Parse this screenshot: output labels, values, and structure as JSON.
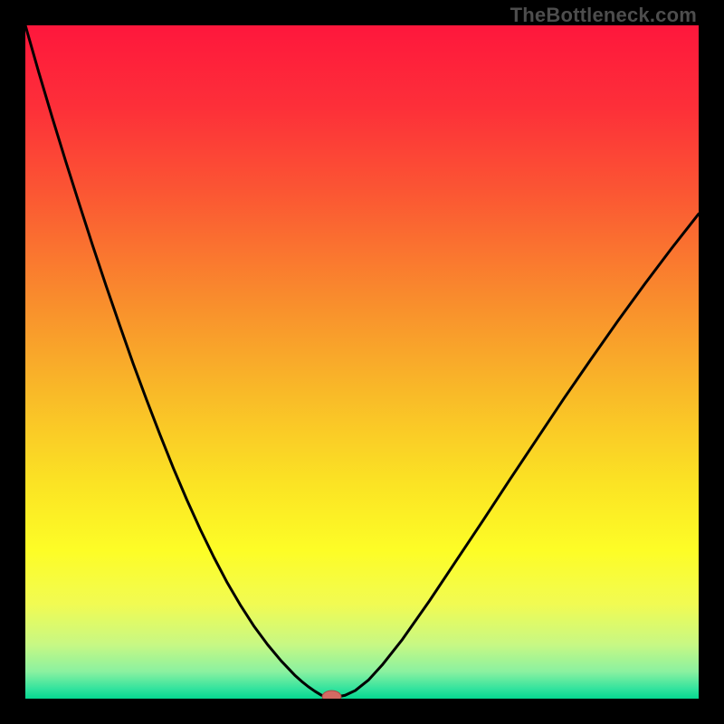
{
  "watermark": "TheBottleneck.com",
  "chart_data": {
    "type": "line",
    "title": "",
    "xlabel": "",
    "ylabel": "",
    "xlim": [
      0,
      1
    ],
    "ylim": [
      0,
      1
    ],
    "axes_visible": false,
    "grid": false,
    "legend": false,
    "background_gradient_stops": [
      {
        "offset": 0.0,
        "color": "#fe173c"
      },
      {
        "offset": 0.12,
        "color": "#fd2f39"
      },
      {
        "offset": 0.25,
        "color": "#fb5733"
      },
      {
        "offset": 0.4,
        "color": "#f98a2d"
      },
      {
        "offset": 0.55,
        "color": "#f9bb28"
      },
      {
        "offset": 0.68,
        "color": "#fbe324"
      },
      {
        "offset": 0.78,
        "color": "#fdfd26"
      },
      {
        "offset": 0.86,
        "color": "#f1fb53"
      },
      {
        "offset": 0.92,
        "color": "#c7f884"
      },
      {
        "offset": 0.96,
        "color": "#8af1a0"
      },
      {
        "offset": 0.985,
        "color": "#34e39e"
      },
      {
        "offset": 1.0,
        "color": "#06d790"
      }
    ],
    "series": [
      {
        "name": "bottleneck-curve",
        "color": "#000000",
        "width": 3,
        "x": [
          0.0,
          0.02,
          0.04,
          0.06,
          0.08,
          0.1,
          0.12,
          0.14,
          0.16,
          0.18,
          0.2,
          0.22,
          0.24,
          0.26,
          0.28,
          0.3,
          0.32,
          0.34,
          0.36,
          0.38,
          0.4,
          0.41,
          0.42,
          0.43,
          0.44,
          0.445,
          0.465,
          0.475,
          0.49,
          0.51,
          0.53,
          0.56,
          0.6,
          0.64,
          0.68,
          0.72,
          0.76,
          0.8,
          0.84,
          0.88,
          0.92,
          0.96,
          1.0
        ],
        "y": [
          1.0,
          0.93,
          0.863,
          0.798,
          0.735,
          0.673,
          0.613,
          0.555,
          0.498,
          0.444,
          0.392,
          0.342,
          0.295,
          0.251,
          0.21,
          0.172,
          0.138,
          0.107,
          0.08,
          0.056,
          0.035,
          0.026,
          0.018,
          0.011,
          0.005,
          0.003,
          0.003,
          0.005,
          0.012,
          0.028,
          0.05,
          0.088,
          0.145,
          0.205,
          0.265,
          0.326,
          0.386,
          0.446,
          0.504,
          0.561,
          0.616,
          0.669,
          0.72
        ]
      }
    ],
    "marker": {
      "name": "optimal-point",
      "x": 0.455,
      "y": 0.003,
      "rx": 0.014,
      "ry": 0.009,
      "fill": "#d36a63",
      "stroke": "#a84b46"
    }
  }
}
